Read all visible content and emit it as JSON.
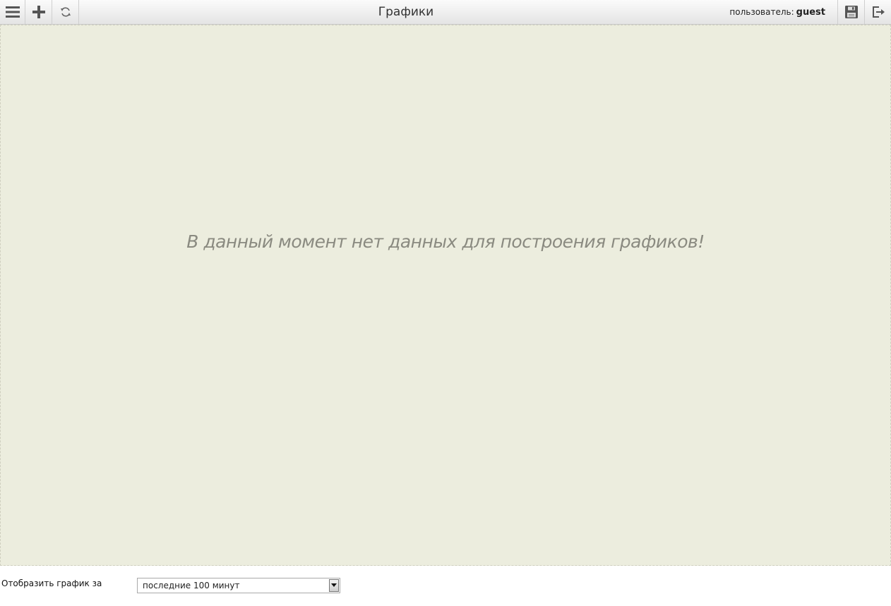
{
  "toolbar": {
    "title": "Графики",
    "user_label": "пользователь:",
    "user_name": "guest",
    "icons": [
      "menu-icon",
      "plus-icon",
      "refresh-icon",
      "save-icon",
      "logout-icon"
    ]
  },
  "chart_area": {
    "message": "В данный момент нет данных для построения графиков!"
  },
  "footer": {
    "period_label": "Отобразить график за",
    "period_select_value": "последние 100 минут"
  },
  "colors": {
    "chart_background": "#ecedde",
    "message_color": "#8a8a80"
  }
}
